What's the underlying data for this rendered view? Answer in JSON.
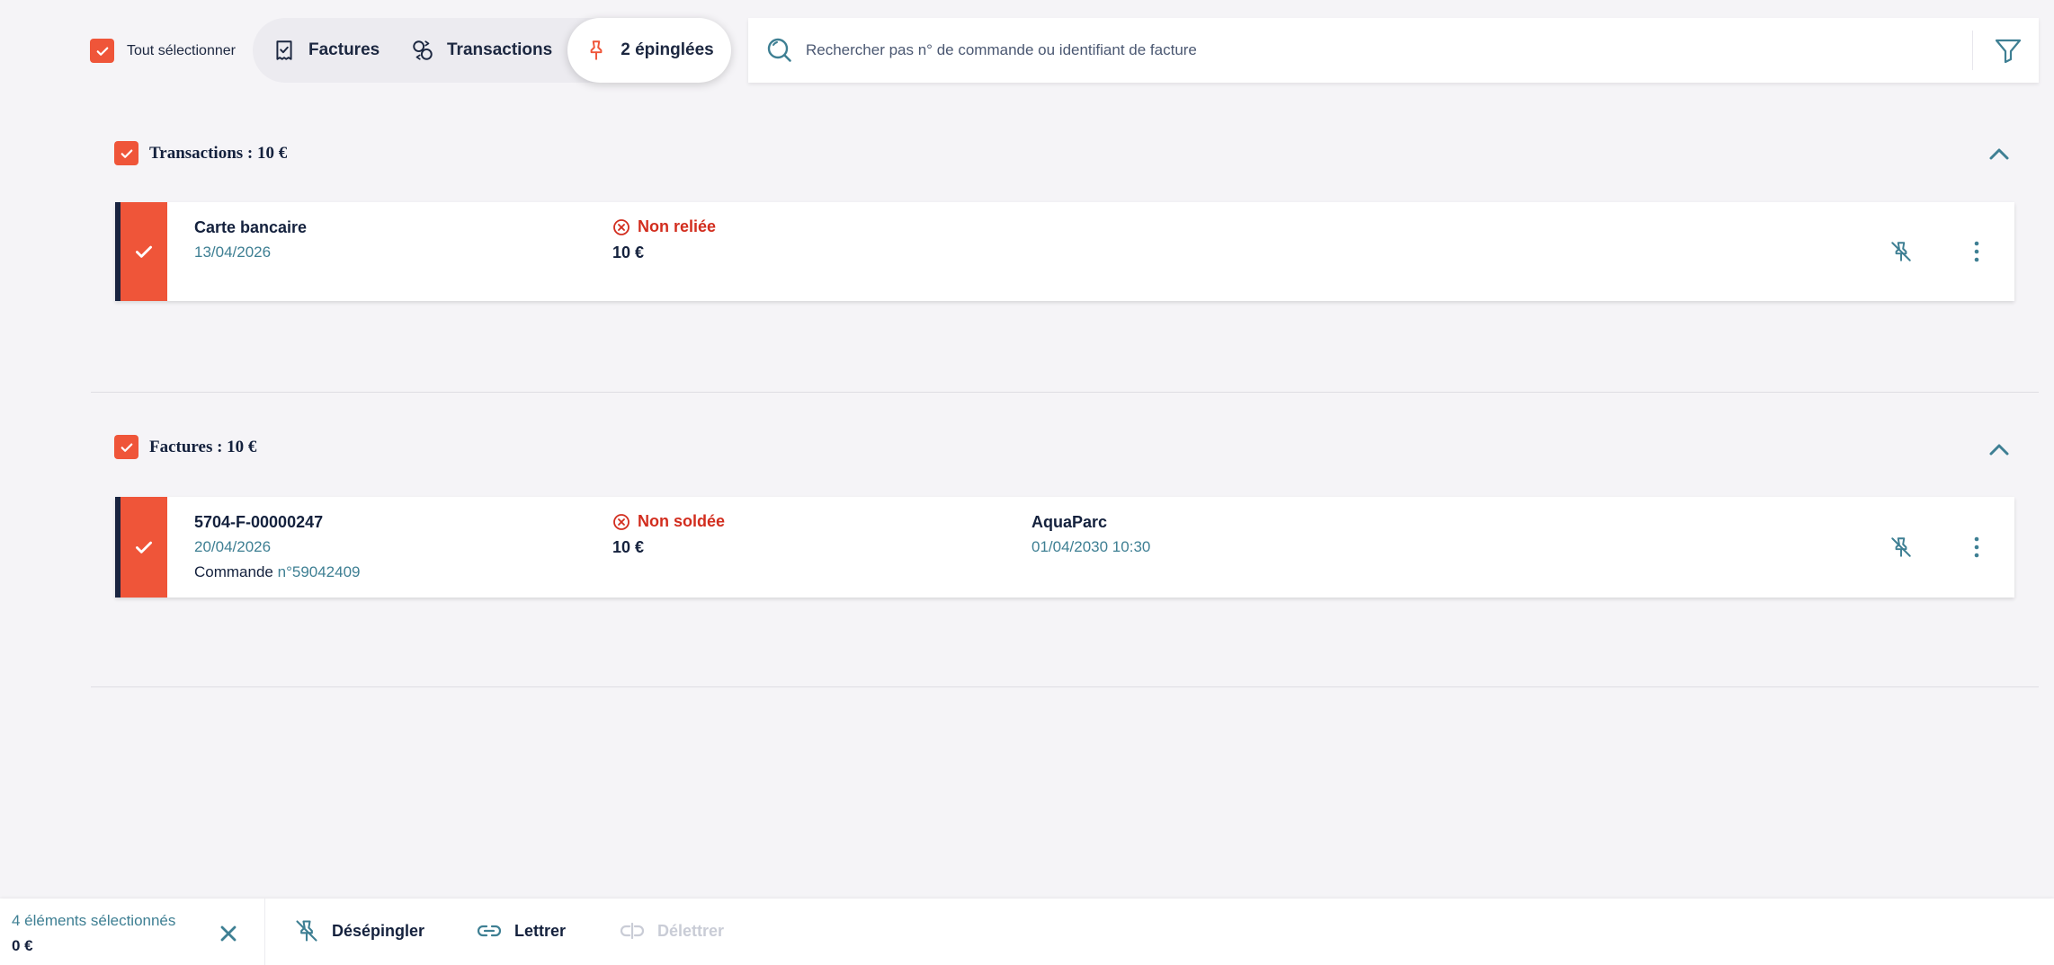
{
  "toolbar": {
    "select_all_label": "Tout sélectionner",
    "tabs": [
      {
        "label": "Factures",
        "icon": "invoice-check-icon"
      },
      {
        "label": "Transactions",
        "icon": "transactions-icon"
      },
      {
        "label": "2 épinglées",
        "icon": "pin-icon",
        "active": true
      }
    ],
    "search_placeholder": "Rechercher pas n° de commande ou identifiant de facture"
  },
  "sections": [
    {
      "title": "Transactions : 10 €",
      "items": [
        {
          "title": "Carte bancaire",
          "date": "13/04/2026",
          "status": "Non reliée",
          "amount": "10 €"
        }
      ]
    },
    {
      "title": "Factures : 10 €",
      "items": [
        {
          "title": "5704-F-00000247",
          "date": "20/04/2026",
          "order_prefix": "Commande ",
          "order_number": "n°59042409",
          "status": "Non soldée",
          "amount": "10 €",
          "customer": "AquaParc",
          "customer_date": "01/04/2030 10:30"
        }
      ]
    }
  ],
  "bottom_bar": {
    "selected_count": "4 éléments sélectionnés",
    "selected_total": "0 €",
    "actions": [
      {
        "label": "Désépingler",
        "icon": "unpin-icon"
      },
      {
        "label": "Lettrer",
        "icon": "link-icon"
      },
      {
        "label": "Délettrer",
        "icon": "unlink-icon",
        "disabled": true
      }
    ]
  },
  "colors": {
    "accent": "#ef5539",
    "teal": "#3e7f93",
    "error": "#d22d1e",
    "text": "#14213d",
    "background": "#f5f4f7"
  }
}
